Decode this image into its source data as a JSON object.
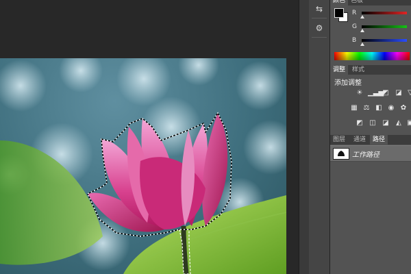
{
  "tools": {
    "history_glyph": "⇆",
    "properties_glyph": "⚙"
  },
  "color_panel": {
    "tabs": [
      "颜色",
      "色板"
    ],
    "channels": [
      {
        "label": "R",
        "color": "#e02424"
      },
      {
        "label": "G",
        "color": "#16c116"
      },
      {
        "label": "B",
        "color": "#2a4dff"
      }
    ],
    "foreground": "#000000",
    "background": "#ffffff"
  },
  "adjustments_panel": {
    "tabs": [
      "调整",
      "样式"
    ],
    "title": "添加调整",
    "icons": [
      "brightness-icon",
      "levels-icon",
      "curves-icon",
      "exposure-icon",
      "vibrance-icon",
      "hue-saturation-icon",
      "color-balance-icon",
      "black-white-icon",
      "photo-filter-icon",
      "channel-mixer-icon",
      "invert-icon",
      "posterize-icon",
      "threshold-icon",
      "gradient-map-icon",
      "selective-color-icon"
    ]
  },
  "paths_panel": {
    "tabs": [
      "图层",
      "通道",
      "路径"
    ],
    "active_tab": "路径",
    "items": [
      {
        "label": "工作路径"
      }
    ]
  }
}
